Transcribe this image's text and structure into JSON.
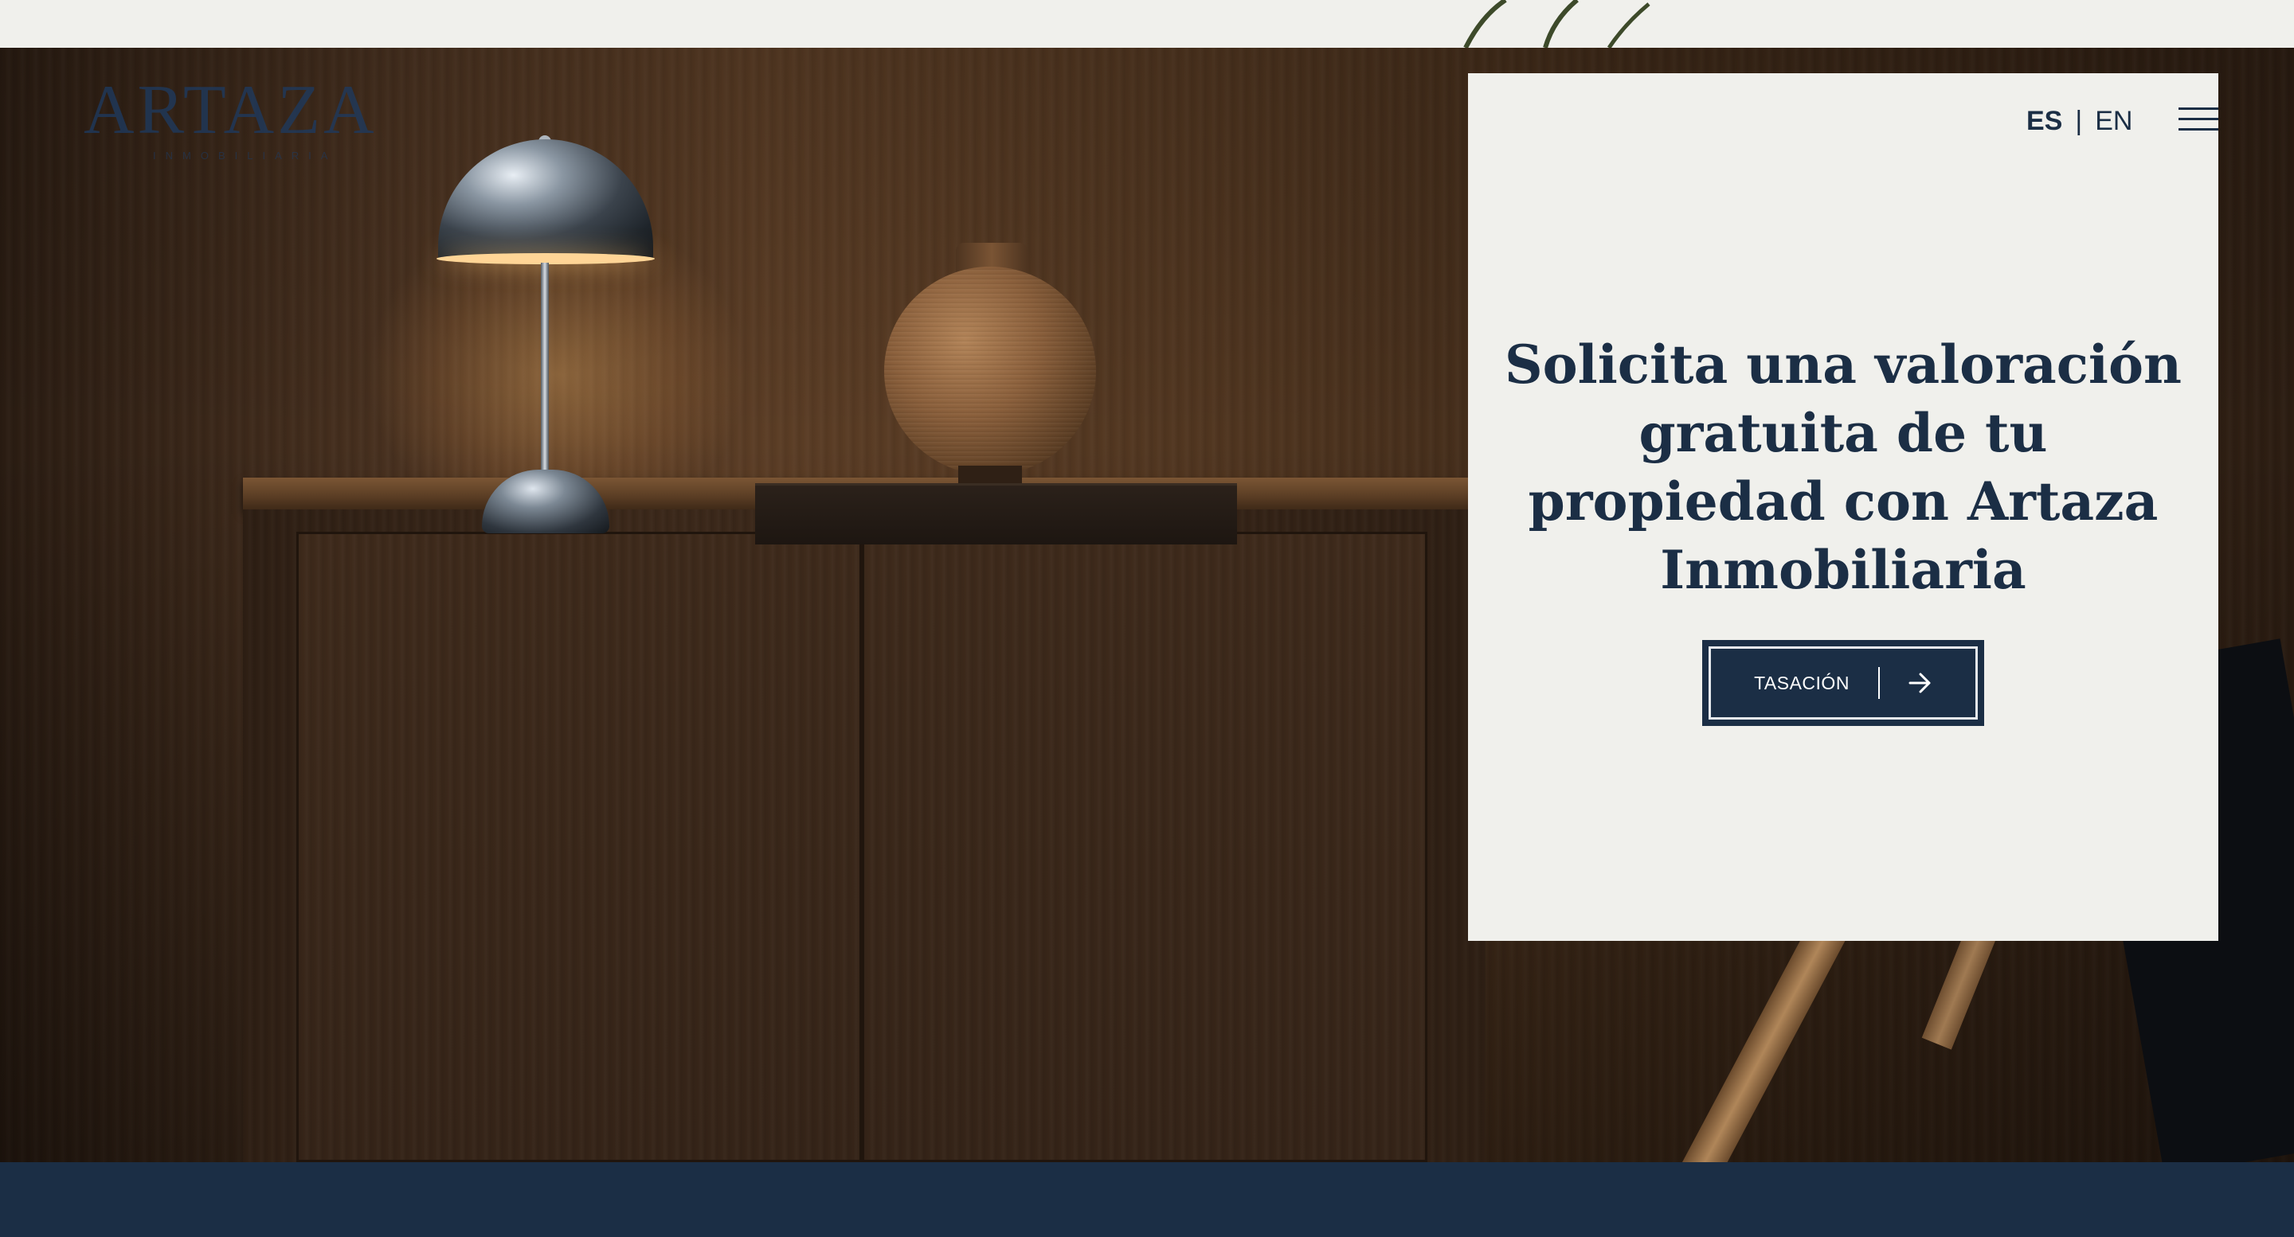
{
  "brand": {
    "logo_text": "ARTAZA",
    "logo_subtext": "INMOBILIARIA"
  },
  "language": {
    "active": "ES",
    "separator": "|",
    "alternate": "EN"
  },
  "hero": {
    "headline": "Solicita una valoración gratuita de tu propiedad con Artaza Inmobiliaria",
    "cta_label": "TASACIÓN"
  },
  "icons": {
    "menu": "hamburger-menu-icon",
    "cta": "arrow-right-icon"
  },
  "colors": {
    "navy": "#1b2e45",
    "card_bg": "#f0f0ec",
    "cta_text": "#ffffff"
  }
}
